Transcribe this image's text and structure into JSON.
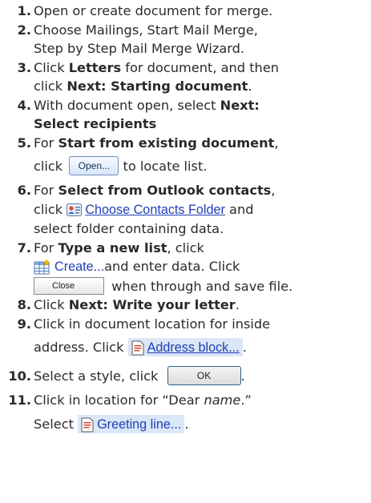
{
  "steps": [
    {
      "n": "1.",
      "t": "Open or create document for merge."
    },
    {
      "n": "2.",
      "a": "Choose Mailings, Start Mail Merge,",
      "b": "Step by Step Mail Merge Wizard."
    },
    {
      "n": "3.",
      "a": "Click ",
      "b": "Letters",
      "c": " for document, and then",
      "d": "click ",
      "e": "Next:  Starting document",
      "f": "."
    },
    {
      "n": "4.",
      "a": "With document open, select ",
      "b": "Next:",
      "c": "Select recipients"
    },
    {
      "n": "5.",
      "a": "For ",
      "b": "Start from existing document",
      "c": ",",
      "d": "click ",
      "e": " to locate list."
    },
    {
      "n": "6.",
      "a": "For ",
      "b": "Select from Outlook contacts",
      "c": ",",
      "d": "click ",
      "e": "and",
      "f": "select folder containing data."
    },
    {
      "n": "7.",
      "a": "For ",
      "b": "Type a new list",
      "c": ", click",
      "d": "and enter data.  Click",
      "e": " when through and save file."
    },
    {
      "n": "8.",
      "a": "Click ",
      "b": "Next:  Write your letter",
      "c": "."
    },
    {
      "n": "9.",
      "a": "Click in document location for inside",
      "b": "address.  Click ",
      "c": "."
    },
    {
      "n": "10.",
      "a": "Select a style, click ",
      "b": "."
    },
    {
      "n": "11.",
      "a": "Click in location for “Dear ",
      "b": "name",
      "c": ".”",
      "d": "Select ",
      "e": "."
    }
  ],
  "ui": {
    "open_button": "Open...",
    "choose_contacts_link": "Choose Contacts Folder",
    "create_link": "Create...",
    "close_button": "Close",
    "address_block_link": "Address block...",
    "ok_button": "OK",
    "greeting_line_link": "Greeting line..."
  }
}
